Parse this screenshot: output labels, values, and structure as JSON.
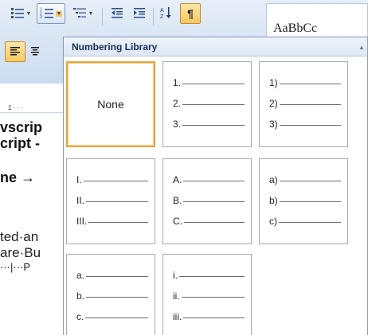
{
  "ribbon": {
    "styles_sample": "AaBbCc",
    "ruler_text": "1 · · ·",
    "icons": {
      "bullets": "bulleted-list-icon",
      "numbering": "numbered-list-icon",
      "multilevel": "multilevel-list-icon",
      "decrease_indent": "decrease-indent-icon",
      "increase_indent": "increase-indent-icon",
      "sort": "sort-icon",
      "show_marks": "pilcrow-icon",
      "align_left": "align-left-icon"
    },
    "accent_color": "#f7c863"
  },
  "document": {
    "frag1": "vscrip",
    "frag2": "cript -",
    "frag3": "ne  →",
    "frag4": "ted·an",
    "frag5": "are·Bu",
    "frag6": "···|···P"
  },
  "numbering_library": {
    "title": "Numbering Library",
    "none_label": "None",
    "tiles": [
      {
        "labels": [
          "1.",
          "2.",
          "3."
        ]
      },
      {
        "labels": [
          "1)",
          "2)",
          "3)"
        ]
      },
      {
        "labels": [
          "I.",
          "II.",
          "III."
        ]
      },
      {
        "labels": [
          "A.",
          "B.",
          "C."
        ]
      },
      {
        "labels": [
          "a)",
          "b)",
          "c)"
        ]
      },
      {
        "labels": [
          "a.",
          "b.",
          "c."
        ]
      },
      {
        "labels": [
          "i.",
          "ii.",
          "iii."
        ]
      }
    ]
  }
}
